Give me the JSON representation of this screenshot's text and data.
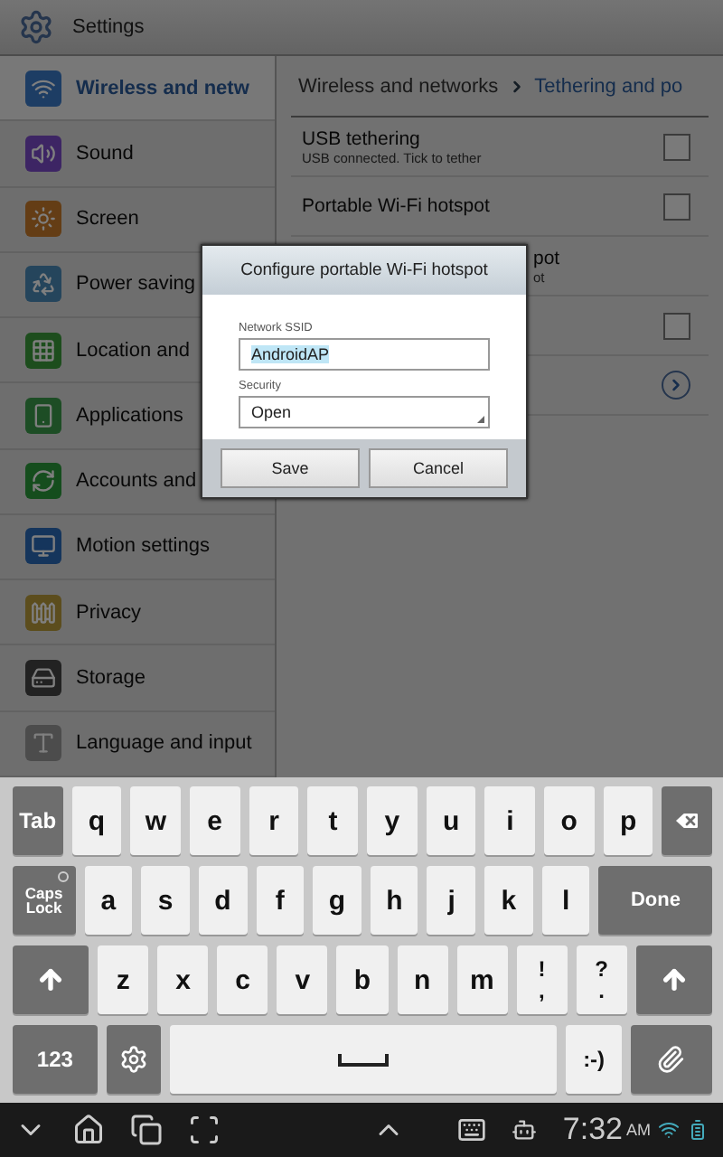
{
  "title_bar": {
    "title": "Settings"
  },
  "sidebar": {
    "items": [
      {
        "label": "Wireless and netw",
        "selected": true
      },
      {
        "label": "Sound",
        "selected": false
      },
      {
        "label": "Screen",
        "selected": false
      },
      {
        "label": "Power saving",
        "selected": false
      },
      {
        "label": "Location and",
        "selected": false
      },
      {
        "label": "Applications",
        "selected": false
      },
      {
        "label": "Accounts and",
        "selected": false
      },
      {
        "label": "Motion settings",
        "selected": false
      },
      {
        "label": "Privacy",
        "selected": false
      },
      {
        "label": "Storage",
        "selected": false
      },
      {
        "label": "Language and input",
        "selected": false
      }
    ]
  },
  "content": {
    "breadcrumb": [
      "Wireless and networks",
      "Tethering and po"
    ],
    "rows": [
      {
        "kind": "checkbox",
        "title": "USB tethering",
        "subtitle": "USB connected. Tick to tether",
        "checked": false
      },
      {
        "kind": "checkbox",
        "title": "Portable Wi-Fi hotspot",
        "checked": false
      },
      {
        "kind": "covered",
        "title": "pot",
        "subtitle": "ot"
      },
      {
        "kind": "checkbox",
        "checked": false
      },
      {
        "kind": "chevron"
      }
    ]
  },
  "dialog": {
    "title": "Configure portable Wi-Fi hotspot",
    "ssid_label": "Network SSID",
    "ssid_value": "AndroidAP",
    "security_label": "Security",
    "security_value": "Open",
    "buttons": [
      "Save",
      "Cancel"
    ]
  },
  "keyboard": {
    "rows": [
      [
        {
          "kind": "fn",
          "label": "Tab"
        },
        {
          "kind": "letter",
          "label": "q"
        },
        {
          "kind": "letter",
          "label": "w"
        },
        {
          "kind": "letter",
          "label": "e"
        },
        {
          "kind": "letter",
          "label": "r"
        },
        {
          "kind": "letter",
          "label": "t"
        },
        {
          "kind": "letter",
          "label": "y"
        },
        {
          "kind": "letter",
          "label": "u"
        },
        {
          "kind": "letter",
          "label": "i"
        },
        {
          "kind": "letter",
          "label": "o"
        },
        {
          "kind": "letter",
          "label": "p"
        },
        {
          "kind": "backspace"
        }
      ],
      [
        {
          "kind": "caps",
          "label": "Caps Lock",
          "on": false
        },
        {
          "kind": "letter",
          "label": "a"
        },
        {
          "kind": "letter",
          "label": "s"
        },
        {
          "kind": "letter",
          "label": "d"
        },
        {
          "kind": "letter",
          "label": "f"
        },
        {
          "kind": "letter",
          "label": "g"
        },
        {
          "kind": "letter",
          "label": "h"
        },
        {
          "kind": "letter",
          "label": "j"
        },
        {
          "kind": "letter",
          "label": "k"
        },
        {
          "kind": "letter",
          "label": "l"
        },
        {
          "kind": "wide",
          "label": "Done"
        }
      ],
      [
        {
          "kind": "shift"
        },
        {
          "kind": "letter",
          "label": "z"
        },
        {
          "kind": "letter",
          "label": "x"
        },
        {
          "kind": "letter",
          "label": "c"
        },
        {
          "kind": "letter",
          "label": "v"
        },
        {
          "kind": "letter",
          "label": "b"
        },
        {
          "kind": "letter",
          "label": "n"
        },
        {
          "kind": "letter",
          "label": "m"
        },
        {
          "kind": "letter",
          "label": "!\n,"
        },
        {
          "kind": "letter",
          "label": "?\n."
        },
        {
          "kind": "shift"
        }
      ],
      [
        {
          "kind": "fnwide",
          "label": "123"
        },
        {
          "kind": "gear"
        },
        {
          "kind": "space"
        },
        {
          "kind": "letter",
          "label": ":-)"
        },
        {
          "kind": "clip"
        }
      ]
    ]
  },
  "status_bar": {
    "time": "7:32",
    "meridiem": "AM"
  }
}
